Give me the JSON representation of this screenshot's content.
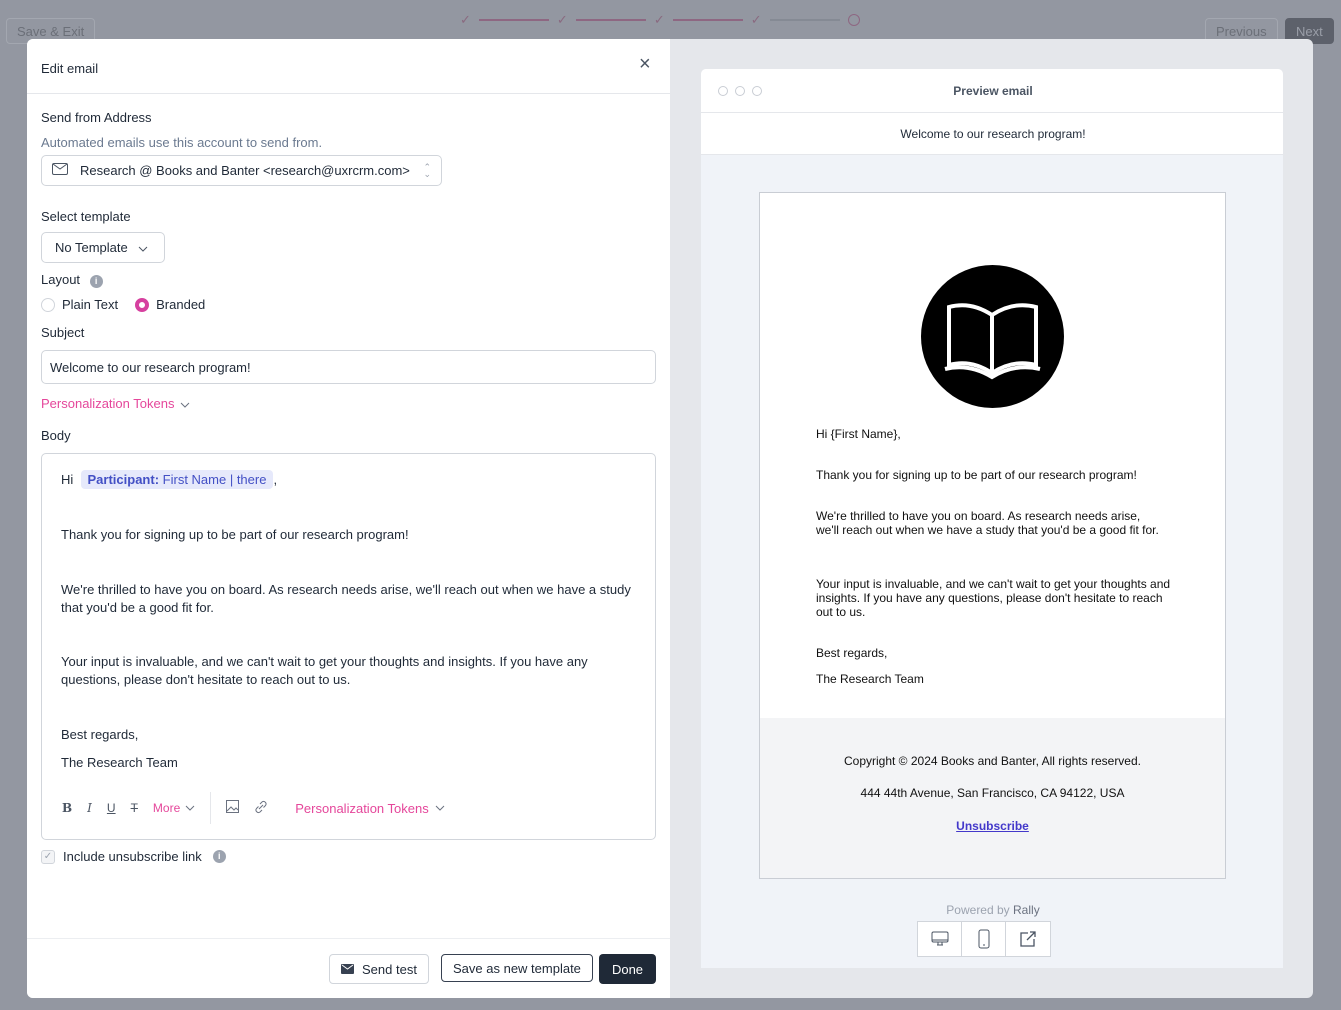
{
  "topbar": {
    "save_exit": "Save & Exit",
    "previous": "Previous",
    "next": "Next",
    "steps_done": 4,
    "steps_total": 5
  },
  "modal": {
    "title": "Edit email",
    "from": {
      "label": "Send from Address",
      "help": "Automated emails use this account to send from.",
      "value": "Research @ Books and Banter <research@uxrcrm.com>"
    },
    "template": {
      "label": "Select template",
      "value": "No Template"
    },
    "layout": {
      "label": "Layout",
      "options": [
        "Plain Text",
        "Branded"
      ],
      "selected": "Branded"
    },
    "subject": {
      "label": "Subject",
      "value": "Welcome to our research program!"
    },
    "tokens_label": "Personalization Tokens",
    "body": {
      "label": "Body",
      "greeting": "Hi",
      "token_key": "Participant:",
      "token_val": "First Name | there",
      "comma": ",",
      "p1": "Thank you for signing up to be part of our research program!",
      "p2": "We're thrilled to have you on board. As research needs arise, we'll reach out when we have a study that you'd be a good fit for.",
      "p3": "Your input is invaluable, and we can't wait to get your thoughts and insights. If you have any questions, please don't hesitate to reach out to us.",
      "p4": "Best regards,",
      "p5": "The Research Team"
    },
    "toolbar": {
      "bold": "B",
      "italic": "I",
      "underline": "U",
      "clear": "T",
      "more": "More",
      "tokens": "Personalization Tokens"
    },
    "unsubscribe_label": "Include unsubscribe link",
    "buttons": {
      "send_test": "Send test",
      "save_template": "Save as new template",
      "done": "Done"
    }
  },
  "preview": {
    "title": "Preview email",
    "subject": "Welcome to our research program!",
    "greeting": "Hi {First Name},",
    "p1": "Thank you for signing up to be part of our research program!",
    "p2": "We're thrilled to have you on board. As research needs arise, we'll reach out when we have a study that you'd be a good fit for.",
    "p3": "Your input is invaluable, and we can't wait to get your thoughts and insights. If you have any questions, please don't hesitate to reach out to us.",
    "p4": "Best regards,",
    "p5": "The Research Team",
    "copyright": "Copyright © 2024 Books and Banter, All rights reserved.",
    "address": "444 44th Avenue, San Francisco, CA 94122, USA",
    "unsubscribe": "Unsubscribe",
    "powered_prefix": "Powered by",
    "powered_brand": "Rally"
  },
  "colors": {
    "accent": "#e5479b",
    "primary_dark": "#1f2937",
    "token_bg": "#e6e9fb",
    "link": "#4338ca"
  }
}
